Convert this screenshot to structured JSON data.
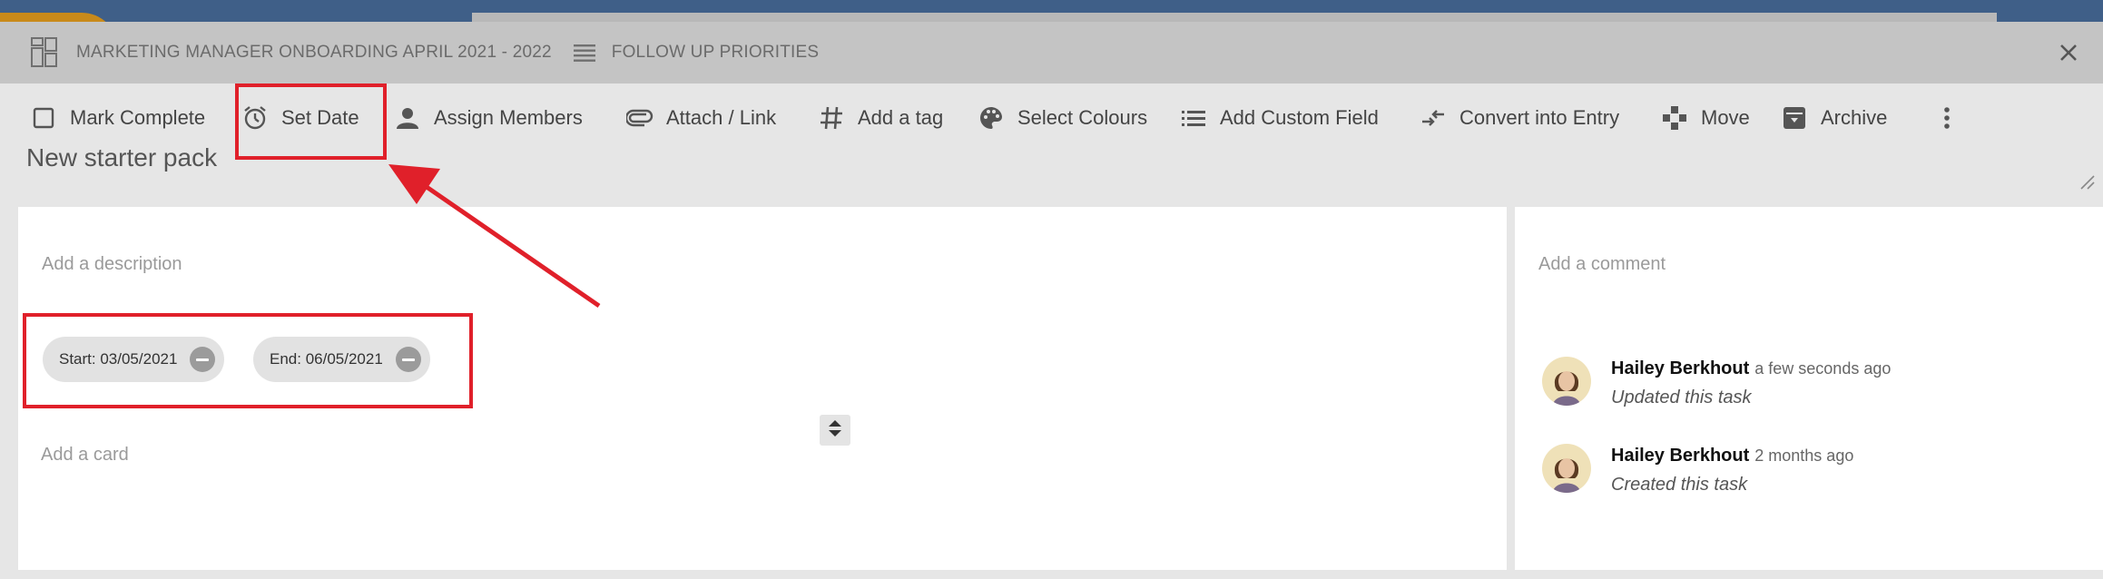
{
  "header": {
    "board_name": "MARKETING MANAGER ONBOARDING APRIL 2021 - 2022",
    "list_name": "FOLLOW UP PRIORITIES"
  },
  "toolbar": {
    "items": [
      {
        "label": "Mark Complete",
        "icon": "checkbox-icon"
      },
      {
        "label": "Set Date",
        "icon": "alarm-clock-icon"
      },
      {
        "label": "Assign Members",
        "icon": "person-icon"
      },
      {
        "label": "Attach / Link",
        "icon": "paperclip-icon"
      },
      {
        "label": "Add a tag",
        "icon": "hashtag-icon"
      },
      {
        "label": "Select Colours",
        "icon": "palette-icon"
      },
      {
        "label": "Add Custom Field",
        "icon": "list-icon"
      },
      {
        "label": "Convert into Entry",
        "icon": "convert-icon"
      },
      {
        "label": "Move",
        "icon": "move-icon"
      },
      {
        "label": "Archive",
        "icon": "archive-icon"
      }
    ]
  },
  "task": {
    "title": "New starter pack",
    "description_placeholder": "Add a description",
    "start_date": "Start: 03/05/2021",
    "end_date": "End: 06/05/2021",
    "card_placeholder": "Add a card"
  },
  "comments": {
    "placeholder": "Add a comment",
    "activity": [
      {
        "name": "Hailey Berkhout",
        "time": "a few seconds ago",
        "description": "Updated this task"
      },
      {
        "name": "Hailey Berkhout",
        "time": "2 months ago",
        "description": "Created this task"
      }
    ]
  },
  "colors": {
    "annotation_red": "#e0202a",
    "header_bg": "#c4c4c4",
    "toolbar_bg": "#e6e6e6"
  }
}
